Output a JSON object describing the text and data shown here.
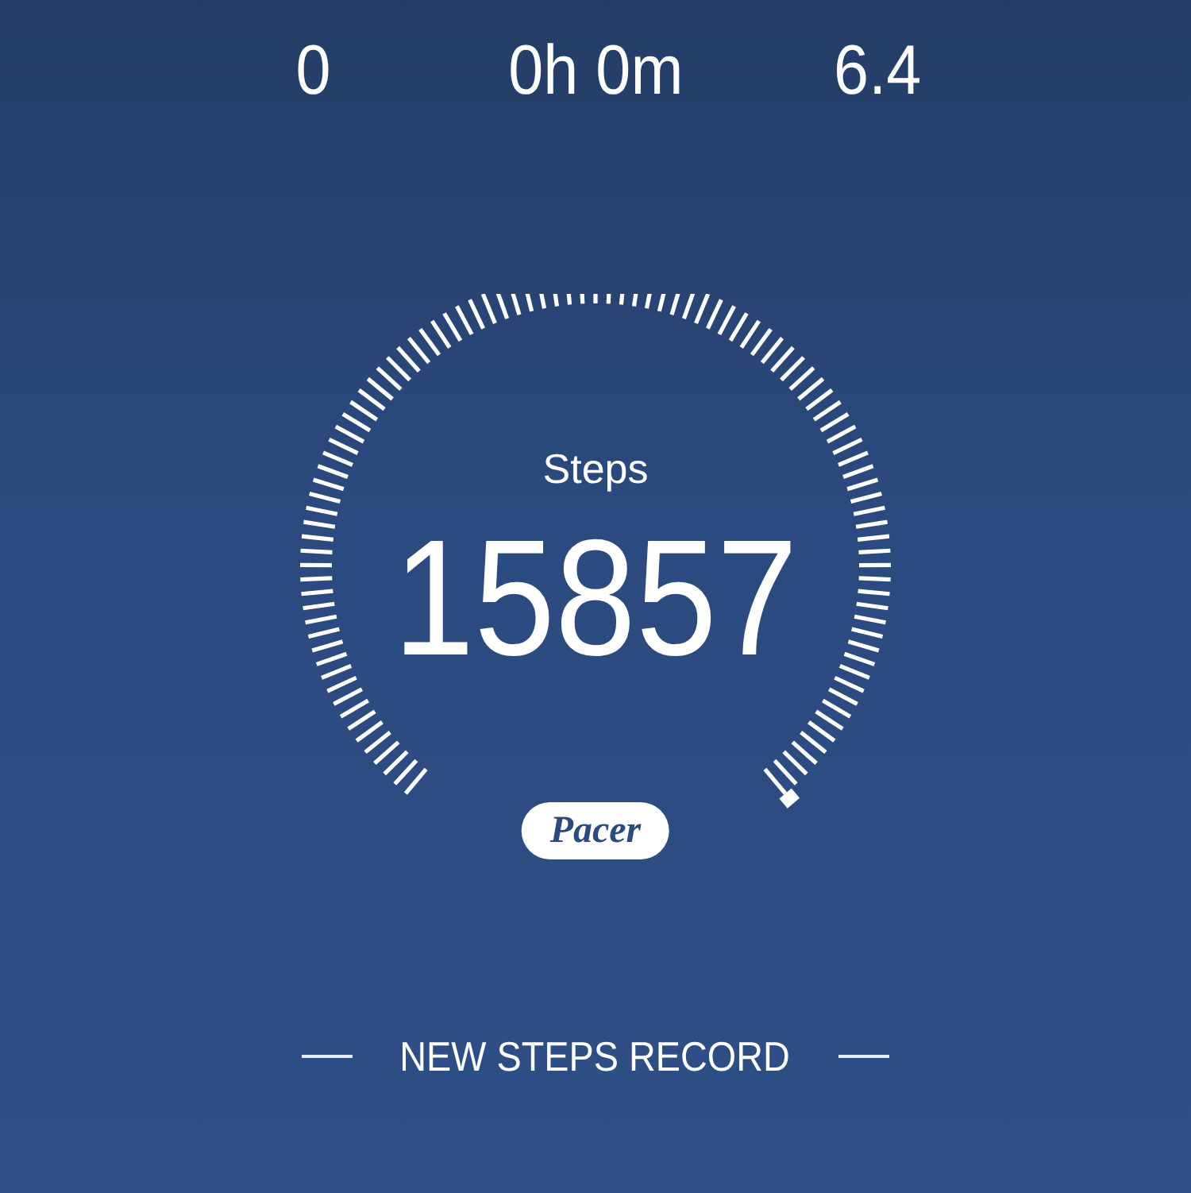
{
  "stats": [
    {
      "value": "0"
    },
    {
      "value": "0h 0m"
    },
    {
      "value": "6.4"
    }
  ],
  "gauge": {
    "label": "Steps",
    "value": "15857"
  },
  "logo": "Pacer",
  "banner": "NEW STEPS RECORD"
}
